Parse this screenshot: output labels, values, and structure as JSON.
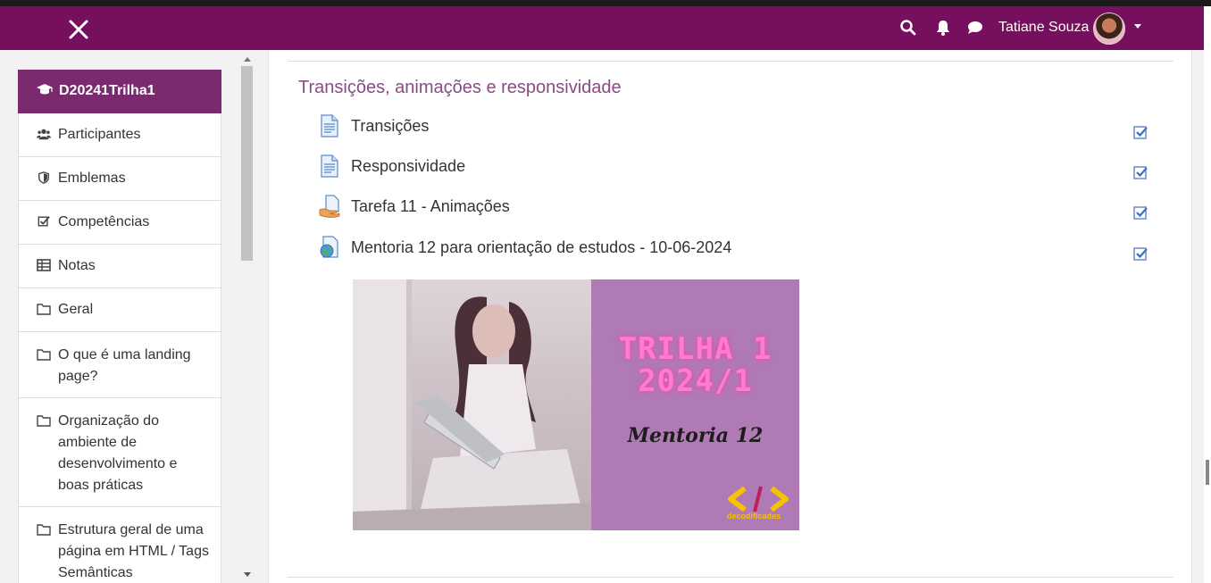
{
  "header": {
    "user_name": "Tatiane Souza",
    "icons": [
      "close-icon",
      "search-icon",
      "bell-icon",
      "chat-icon",
      "chevron-down-icon"
    ],
    "colors": {
      "navbar": "#76105e",
      "accent": "#7b2a6f"
    }
  },
  "sidebar": {
    "course": "D20241Trilha1",
    "items": [
      {
        "label": "Participantes",
        "icon": "users-icon"
      },
      {
        "label": "Emblemas",
        "icon": "shield-icon"
      },
      {
        "label": "Competências",
        "icon": "checkbox-icon"
      },
      {
        "label": "Notas",
        "icon": "table-icon"
      },
      {
        "label": "Geral",
        "icon": "folder-icon"
      },
      {
        "label": "O que é uma landing page?",
        "icon": "folder-icon"
      },
      {
        "label": "Organização do ambiente de desenvolvimento e boas práticas",
        "icon": "folder-icon"
      },
      {
        "label": "Estrutura geral de uma página em HTML / Tags Semânticas",
        "icon": "folder-icon"
      }
    ]
  },
  "main": {
    "section_title": "Transições, animações e responsividade",
    "activities": [
      {
        "label": "Transições",
        "icon": "page-icon",
        "done": true
      },
      {
        "label": "Responsividade",
        "icon": "page-icon",
        "done": true
      },
      {
        "label": "Tarefa 11 - Animações",
        "icon": "assignment-icon",
        "done": true
      },
      {
        "label": "Mentoria 12 para orientação de estudos - 10-06-2024",
        "icon": "url-icon",
        "done": true
      }
    ],
    "banner": {
      "line1": "TRILHA 1",
      "line2": "2024/1",
      "subtitle": "Mentoria 12",
      "logo_text": "decodificadas"
    }
  }
}
